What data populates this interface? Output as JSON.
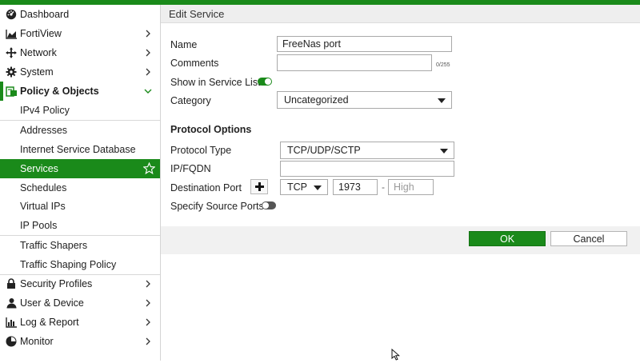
{
  "sidebar": {
    "items": [
      {
        "label": "Dashboard",
        "icon": "dashboard-icon"
      },
      {
        "label": "FortiView",
        "icon": "chart-icon"
      },
      {
        "label": "Network",
        "icon": "network-icon"
      },
      {
        "label": "System",
        "icon": "gear-icon"
      },
      {
        "label": "Policy & Objects",
        "icon": "policy-icon"
      },
      {
        "label": "IPv4 Policy"
      },
      {
        "label": "Addresses"
      },
      {
        "label": "Internet Service Database"
      },
      {
        "label": "Services"
      },
      {
        "label": "Schedules"
      },
      {
        "label": "Virtual IPs"
      },
      {
        "label": "IP Pools"
      },
      {
        "label": "Traffic Shapers"
      },
      {
        "label": "Traffic Shaping Policy"
      },
      {
        "label": "Security Profiles",
        "icon": "lock-icon"
      },
      {
        "label": "User & Device",
        "icon": "user-icon"
      },
      {
        "label": "Log & Report",
        "icon": "log-icon"
      },
      {
        "label": "Monitor",
        "icon": "monitor-icon"
      }
    ]
  },
  "header": {
    "title": "Edit Service"
  },
  "form": {
    "name_label": "Name",
    "name_value": "FreeNas port",
    "comments_label": "Comments",
    "comments_counter": "0/255",
    "show_label": "Show in Service List",
    "show_enabled": true,
    "category_label": "Category",
    "category_value": "Uncategorized"
  },
  "protocol": {
    "heading": "Protocol Options",
    "type_label": "Protocol Type",
    "type_value": "TCP/UDP/SCTP",
    "ipfqdn_label": "IP/FQDN",
    "ipfqdn_value": "",
    "dest_label": "Destination Port",
    "dest_proto": "TCP",
    "dest_low": "1973",
    "dest_sep": "-",
    "dest_high_placeholder": "High",
    "source_label": "Specify Source Ports",
    "source_enabled": false
  },
  "footer": {
    "ok_label": "OK",
    "cancel_label": "Cancel"
  },
  "colors": {
    "accent": "#1a8a1a",
    "selected_text": "#ffffff"
  }
}
